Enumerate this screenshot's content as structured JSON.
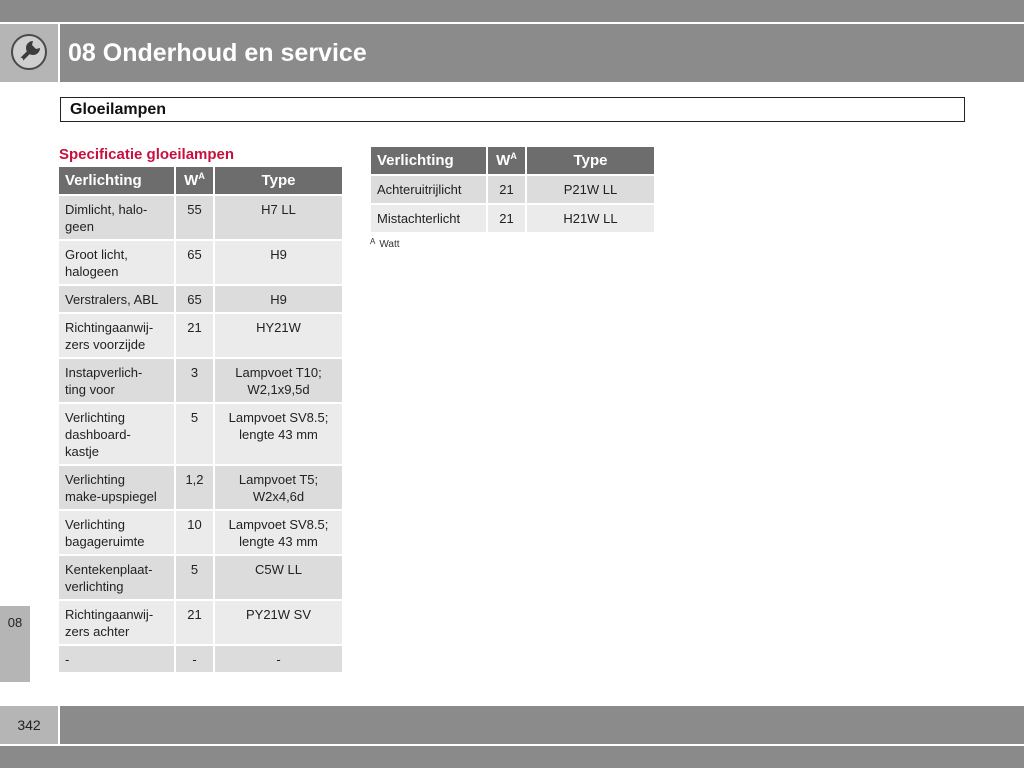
{
  "header": {
    "title": "08 Onderhoud en service"
  },
  "section": {
    "title": "Gloeilampen"
  },
  "spec": {
    "title": "Specificatie gloeilampen",
    "columns": {
      "lighting": "Verlichting",
      "watt": "W",
      "watt_sup": "A",
      "type": "Type"
    }
  },
  "left_table": {
    "rows": [
      {
        "lighting": "Dimlicht, halo-\ngeen",
        "watt": "55",
        "type": "H7 LL"
      },
      {
        "lighting": "Groot licht,\nhalogeen",
        "watt": "65",
        "type": "H9"
      },
      {
        "lighting": "Verstralers, ABL",
        "watt": "65",
        "type": "H9"
      },
      {
        "lighting": "Richtingaanwij-\nzers voorzijde",
        "watt": "21",
        "type": "HY21W"
      },
      {
        "lighting": "Instapverlich-\nting voor",
        "watt": "3",
        "type": "Lampvoet T10;\nW2,1x9,5d"
      },
      {
        "lighting": "Verlichting\ndashboard-\nkastje",
        "watt": "5",
        "type": "Lampvoet SV8.5;\nlengte 43 mm"
      },
      {
        "lighting": "Verlichting\nmake-upspiegel",
        "watt": "1,2",
        "type": "Lampvoet T5;\nW2x4,6d"
      },
      {
        "lighting": "Verlichting\nbagageruimte",
        "watt": "10",
        "type": "Lampvoet SV8.5;\nlengte 43 mm"
      },
      {
        "lighting": "Kentekenplaat-\nverlichting",
        "watt": "5",
        "type": "C5W LL"
      },
      {
        "lighting": "Richtingaanwij-\nzers achter",
        "watt": "21",
        "type": "PY21W SV"
      },
      {
        "lighting": "-",
        "watt": "-",
        "type": "-"
      }
    ]
  },
  "right_table": {
    "rows": [
      {
        "lighting": "Achteruitrijlicht",
        "watt": "21",
        "type": "P21W LL"
      },
      {
        "lighting": "Mistachterlicht",
        "watt": "21",
        "type": "H21W LL"
      }
    ]
  },
  "footnote": {
    "mark": "A",
    "text": "Watt"
  },
  "side_tab": {
    "label": "08"
  },
  "footer": {
    "page_number": "342"
  },
  "colors": {
    "header_bar": "#8b8b8b",
    "icon_box": "#b5b5b5",
    "spec_title": "#c8103e",
    "table_header": "#6d6d6d",
    "row_shade": "#dcdcdc",
    "row_light": "#ebebeb"
  },
  "icons": {
    "header": "wrench-icon"
  }
}
